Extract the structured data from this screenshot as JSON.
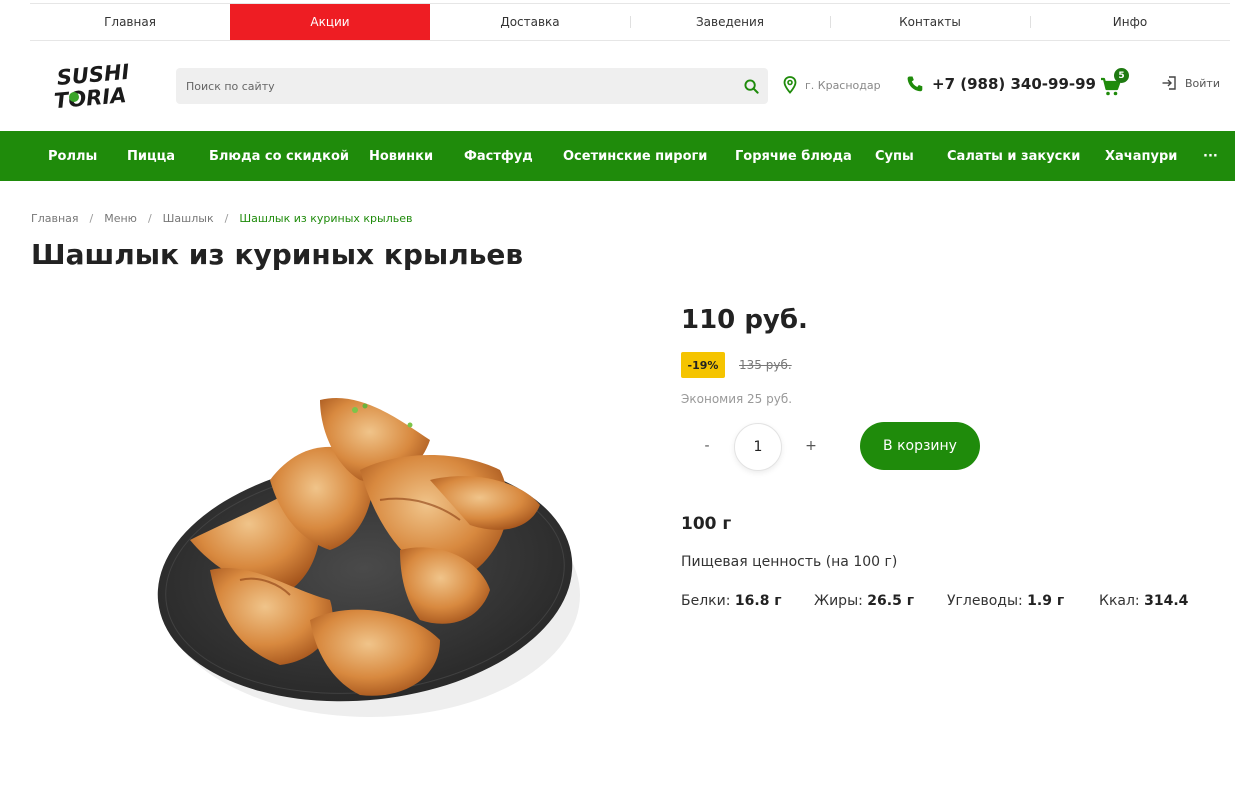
{
  "top_nav": [
    {
      "label": "Главная",
      "active": false
    },
    {
      "label": "Акции",
      "active": true
    },
    {
      "label": "Доставка",
      "active": false
    },
    {
      "label": "Заведения",
      "active": false
    },
    {
      "label": "Контакты",
      "active": false
    },
    {
      "label": "Инфо",
      "active": false
    }
  ],
  "header": {
    "logo_text": [
      "SUSHI",
      "TORIA"
    ],
    "search_placeholder": "Поиск по сайту",
    "city": "г. Краснодар",
    "phone": "+7 (988) 340-99-99",
    "cart_count": "5",
    "login_label": "Войти"
  },
  "main_menu": [
    "Роллы",
    "Пицца",
    "Блюда со скидкой",
    "Новинки",
    "Фастфуд",
    "Осетинские пироги",
    "Горячие блюда",
    "Супы",
    "Салаты и закуски",
    "Хачапури",
    "···"
  ],
  "breadcrumb": [
    "Главная",
    "Меню",
    "Шашлык",
    "Шашлык из куриных крыльев"
  ],
  "product": {
    "title": "Шашлык из куриных крыльев",
    "price": "110 руб.",
    "discount": "-19%",
    "old_price": "135 руб.",
    "savings": "Экономия 25 руб.",
    "qty_minus": "-",
    "qty_value": "1",
    "qty_plus": "+",
    "add_to_cart": "В корзину",
    "weight": "100 г",
    "nutrition_title": "Пищевая ценность (на 100 г)",
    "nutrition": [
      {
        "label": "Белки:",
        "value": "16.8 г"
      },
      {
        "label": "Жиры:",
        "value": "26.5 г"
      },
      {
        "label": "Углеводы:",
        "value": "1.9 г"
      },
      {
        "label": "Ккал:",
        "value": "314.4"
      }
    ]
  },
  "colors": {
    "accent_green": "#1f8b0b",
    "promo_red": "#ee1d23",
    "badge_yellow": "#f5c400"
  }
}
